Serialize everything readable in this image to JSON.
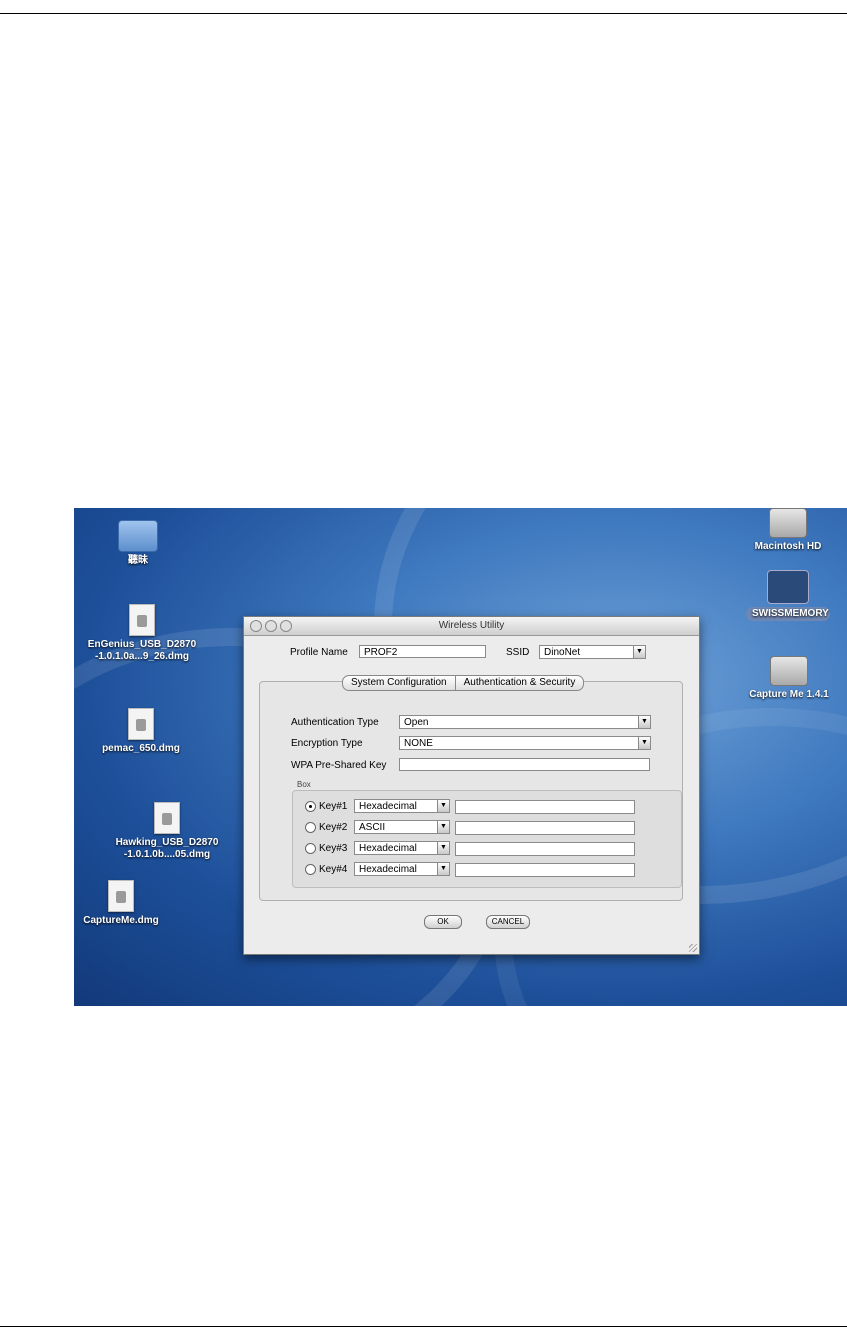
{
  "desktop": {
    "icons": [
      {
        "label": "聽昧",
        "kind": "folder"
      },
      {
        "label": "EnGenius_USB_D2870\n-1.0.1.0a...9_26.dmg",
        "kind": "file"
      },
      {
        "label": "pemac_650.dmg",
        "kind": "file"
      },
      {
        "label": "Hawking_USB_D2870\n-1.0.1.0b....05.dmg",
        "kind": "file"
      },
      {
        "label": "CaptureMe.dmg",
        "kind": "file"
      },
      {
        "label": "Macintosh HD",
        "kind": "disk"
      },
      {
        "label": "SWISSMEMORY",
        "kind": "disk"
      },
      {
        "label": "Capture Me 1.4.1",
        "kind": "disk"
      }
    ]
  },
  "window": {
    "title": "Wireless Utility",
    "profile_name_label": "Profile Name",
    "profile_name_value": "PROF2",
    "ssid_label": "SSID",
    "ssid_value": "DinoNet",
    "tabs": [
      "System Configuration",
      "Authentication & Security"
    ],
    "auth_type_label": "Authentication Type",
    "auth_type_value": "Open",
    "enc_type_label": "Encryption Type",
    "enc_type_value": "NONE",
    "wpa_label": "WPA Pre-Shared Key",
    "wpa_value": "",
    "box_label": "Box",
    "keys": [
      {
        "label": "Key#1",
        "format": "Hexadecimal",
        "value": "",
        "selected": true
      },
      {
        "label": "Key#2",
        "format": "ASCII",
        "value": "",
        "selected": false
      },
      {
        "label": "Key#3",
        "format": "Hexadecimal",
        "value": "",
        "selected": false
      },
      {
        "label": "Key#4",
        "format": "Hexadecimal",
        "value": "",
        "selected": false
      }
    ],
    "ok_label": "OK",
    "cancel_label": "CANCEL"
  }
}
